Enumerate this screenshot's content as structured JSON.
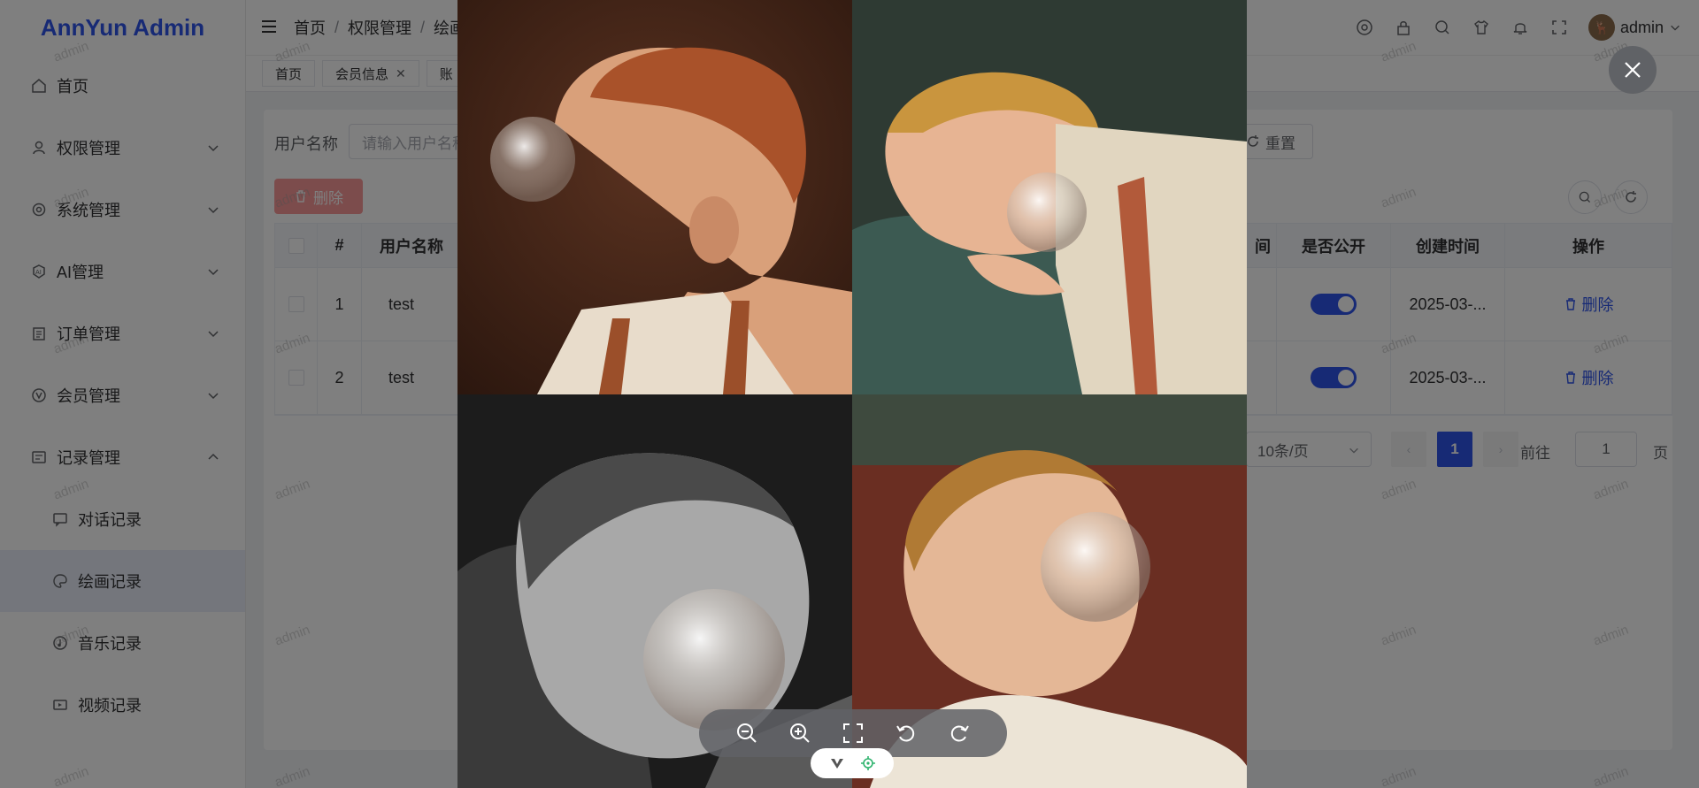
{
  "app": {
    "title": "AnnYun Admin"
  },
  "sidebar": {
    "items": [
      {
        "label": "首页",
        "icon": "home-icon"
      },
      {
        "label": "权限管理",
        "icon": "user-icon"
      },
      {
        "label": "系统管理",
        "icon": "settings-icon"
      },
      {
        "label": "AI管理",
        "icon": "ai-icon"
      },
      {
        "label": "订单管理",
        "icon": "clipboard-icon"
      },
      {
        "label": "会员管理",
        "icon": "vip-icon"
      },
      {
        "label": "记录管理",
        "icon": "record-icon"
      }
    ],
    "sub_items": [
      {
        "label": "对话记录",
        "icon": "chat-icon"
      },
      {
        "label": "绘画记录",
        "icon": "palette-icon"
      },
      {
        "label": "音乐记录",
        "icon": "music-icon"
      },
      {
        "label": "视频记录",
        "icon": "video-icon"
      }
    ]
  },
  "header": {
    "breadcrumb": [
      "首页",
      "权限管理",
      "绘画"
    ],
    "user": "admin"
  },
  "tags": [
    {
      "label": "首页"
    },
    {
      "label": "会员信息"
    },
    {
      "label": "账"
    }
  ],
  "search": {
    "label": "用户名称",
    "placeholder": "请输入用户名称",
    "reset_label": "重置"
  },
  "toolbar": {
    "delete_label": "删除"
  },
  "table": {
    "columns": [
      "#",
      "用户名称",
      "间",
      "是否公开",
      "创建时间",
      "操作"
    ],
    "rows": [
      {
        "index": "1",
        "username": "test",
        "public": true,
        "created": "2025-03-...",
        "action": "删除"
      },
      {
        "index": "2",
        "username": "test",
        "public": true,
        "created": "2025-03-...",
        "action": "删除"
      }
    ]
  },
  "pagination": {
    "page_size": "10条/页",
    "current_page": "1",
    "goto_label": "前往",
    "goto_value": "1",
    "page_suffix": "页"
  },
  "watermark": "admin",
  "colors": {
    "accent": "#2f54eb",
    "danger_light": "#f89898"
  }
}
